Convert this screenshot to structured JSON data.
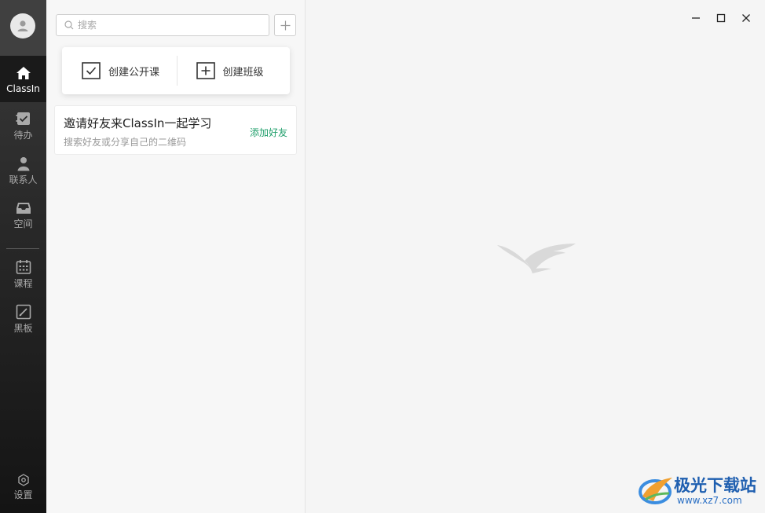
{
  "sidebar": {
    "items": [
      {
        "id": "classin",
        "label": "ClassIn",
        "icon": "home-icon",
        "active": true
      },
      {
        "id": "todo",
        "label": "待办",
        "icon": "todo-icon",
        "active": false
      },
      {
        "id": "contacts",
        "label": "联系人",
        "icon": "person-icon",
        "active": false
      },
      {
        "id": "space",
        "label": "空间",
        "icon": "inbox-icon",
        "active": false
      },
      {
        "id": "courses",
        "label": "课程",
        "icon": "calendar-icon",
        "active": false
      },
      {
        "id": "blackboard",
        "label": "黑板",
        "icon": "blackboard-icon",
        "active": false
      }
    ],
    "settings_label": "设置"
  },
  "panel": {
    "search_placeholder": "搜索",
    "create": {
      "open_class_label": "创建公开课",
      "class_label": "创建班级"
    },
    "invite": {
      "title": "邀请好友来ClassIn一起学习",
      "subtitle": "搜索好友或分享自己的二维码",
      "action_label": "添加好友"
    }
  },
  "watermark": {
    "brand": "极光下载站",
    "url": "www.xz7.com"
  },
  "colors": {
    "accent_green": "#1e9e6a",
    "rail_dark": "#1a1a1a",
    "watermark_blue": "#1f5fb0"
  }
}
